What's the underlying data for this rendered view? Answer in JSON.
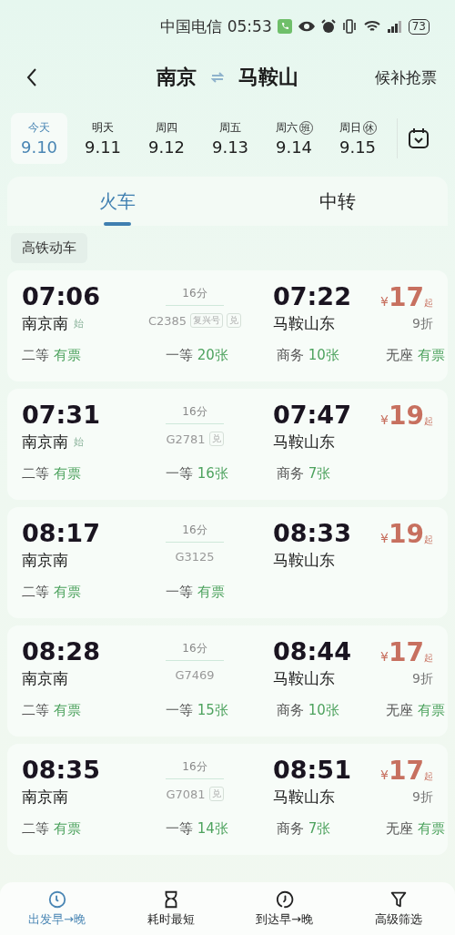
{
  "status_bar": {
    "carrier": "中国电信",
    "time": "05:53",
    "battery": "73"
  },
  "header": {
    "from": "南京",
    "to": "马鞍山",
    "action": "候补抢票"
  },
  "dates": [
    {
      "weekday": "今天",
      "date": "9.10",
      "selected": true
    },
    {
      "weekday": "明天",
      "date": "9.11",
      "selected": false
    },
    {
      "weekday": "周四",
      "date": "9.12",
      "selected": false
    },
    {
      "weekday": "周五",
      "date": "9.13",
      "selected": false
    },
    {
      "weekday": "周六",
      "badge": "班",
      "date": "9.14",
      "selected": false
    },
    {
      "weekday": "周日",
      "badge": "休",
      "date": "9.15",
      "selected": false
    }
  ],
  "tabs": [
    {
      "label": "火车",
      "selected": true
    },
    {
      "label": "中转",
      "selected": false
    }
  ],
  "filter_chip": "高铁动车",
  "trains": [
    {
      "depart": "07:06",
      "depart_station": "南京南",
      "start_badge": "始",
      "duration": "16分",
      "number": "C2385",
      "tags": [
        "复兴号",
        "兑"
      ],
      "arrive": "07:22",
      "arrive_station": "马鞍山东",
      "currency": "¥",
      "price": "17",
      "price_suffix": "起",
      "discount": "9折",
      "seats": [
        {
          "class": "二等",
          "availability": "有票"
        },
        {
          "class": "一等",
          "availability": "20张"
        },
        {
          "class": "商务",
          "availability": "10张"
        },
        {
          "class": "无座",
          "availability": "有票"
        }
      ]
    },
    {
      "depart": "07:31",
      "depart_station": "南京南",
      "start_badge": "始",
      "duration": "16分",
      "number": "G2781",
      "tags": [
        "兑"
      ],
      "arrive": "07:47",
      "arrive_station": "马鞍山东",
      "currency": "¥",
      "price": "19",
      "price_suffix": "起",
      "seats": [
        {
          "class": "二等",
          "availability": "有票"
        },
        {
          "class": "一等",
          "availability": "16张"
        },
        {
          "class": "商务",
          "availability": "7张"
        }
      ]
    },
    {
      "depart": "08:17",
      "depart_station": "南京南",
      "duration": "16分",
      "number": "G3125",
      "arrive": "08:33",
      "arrive_station": "马鞍山东",
      "currency": "¥",
      "price": "19",
      "price_suffix": "起",
      "seats": [
        {
          "class": "二等",
          "availability": "有票"
        },
        {
          "class": "一等",
          "availability": "有票"
        }
      ]
    },
    {
      "depart": "08:28",
      "depart_station": "南京南",
      "duration": "16分",
      "number": "G7469",
      "arrive": "08:44",
      "arrive_station": "马鞍山东",
      "currency": "¥",
      "price": "17",
      "price_suffix": "起",
      "discount": "9折",
      "seats": [
        {
          "class": "二等",
          "availability": "有票"
        },
        {
          "class": "一等",
          "availability": "15张"
        },
        {
          "class": "商务",
          "availability": "10张"
        },
        {
          "class": "无座",
          "availability": "有票"
        }
      ]
    },
    {
      "depart": "08:35",
      "depart_station": "南京南",
      "duration": "16分",
      "number": "G7081",
      "tags": [
        "兑"
      ],
      "arrive": "08:51",
      "arrive_station": "马鞍山东",
      "currency": "¥",
      "price": "17",
      "price_suffix": "起",
      "discount": "9折",
      "seats": [
        {
          "class": "二等",
          "availability": "有票"
        },
        {
          "class": "一等",
          "availability": "14张"
        },
        {
          "class": "商务",
          "availability": "7张"
        },
        {
          "class": "无座",
          "availability": "有票"
        }
      ]
    }
  ],
  "bottom_nav": [
    {
      "kind": "clock",
      "label": "出发早→晚",
      "selected": true
    },
    {
      "kind": "hourglass",
      "label": "耗时最短",
      "selected": false
    },
    {
      "kind": "arrival",
      "label": "到达早→晚",
      "selected": false
    },
    {
      "kind": "filter",
      "label": "高级筛选",
      "selected": false
    }
  ]
}
